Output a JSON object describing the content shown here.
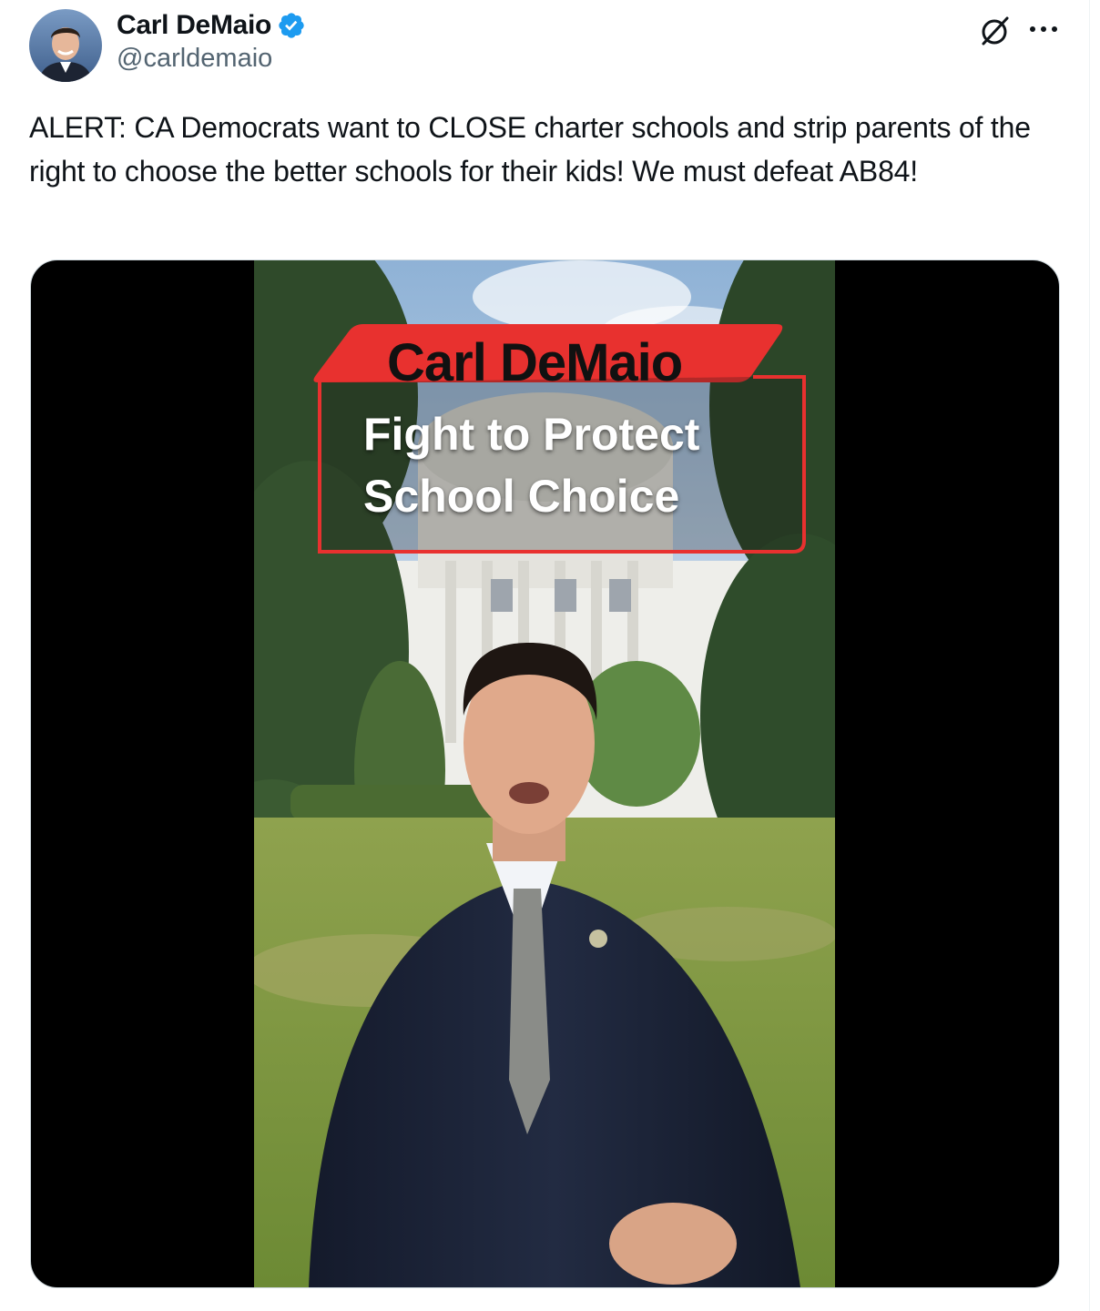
{
  "author": {
    "display_name": "Carl DeMaio",
    "handle": "@carldemaio",
    "verified_icon": "verified-badge-icon",
    "avatar_icon": "avatar"
  },
  "actions": {
    "grok_icon": "grok-icon",
    "more_icon": "more-options-icon"
  },
  "tweet": {
    "text": "ALERT: CA Democrats want to CLOSE charter schools and strip parents of the right to choose the better schools for their kids! We must defeat AB84!"
  },
  "media": {
    "type": "video",
    "overlay_name": "Carl DeMaio",
    "overlay_line1": "Fight to Protect",
    "overlay_line2": "School Choice"
  },
  "colors": {
    "verified": "#1d9bf0",
    "banner_red": "#e8312f",
    "text_primary": "#0f1419",
    "text_secondary": "#536471"
  }
}
